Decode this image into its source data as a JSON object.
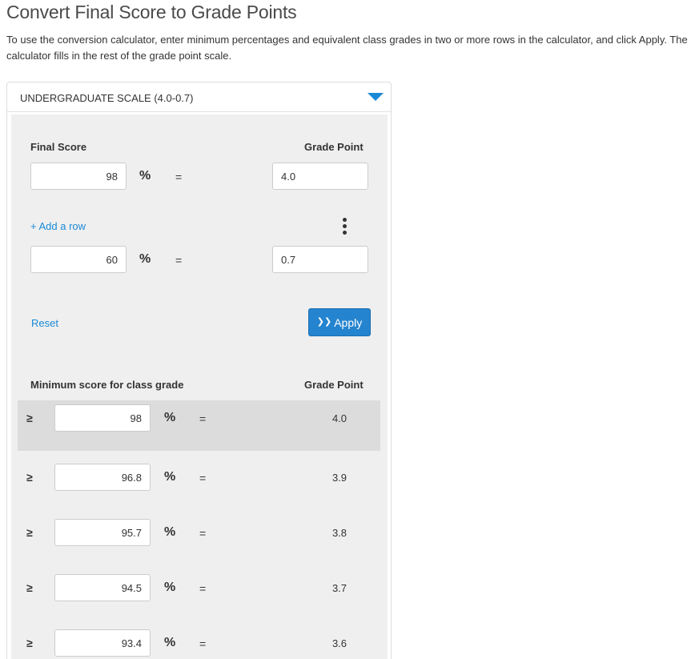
{
  "title": "Convert Final Score to Grade Points",
  "instructions": "To use the conversion calculator, enter minimum percentages and equivalent class grades in two or more rows in the calculator, and click Apply. The calculator fills in the rest of the grade point scale.",
  "scale_select": {
    "value": "UNDERGRADUATE SCALE (4.0-0.7)",
    "icon": "chevron-down-icon"
  },
  "calculator": {
    "final_score_header": "Final Score",
    "grade_point_header": "Grade Point",
    "percent_symbol": "%",
    "equals_symbol": "=",
    "rows": [
      {
        "score": "98",
        "grade_point": "4.0"
      },
      {
        "score": "60",
        "grade_point": "0.7"
      }
    ],
    "add_row_label": "+ Add a row",
    "more_icon": "vertical-ellipsis-icon",
    "reset_label": "Reset",
    "apply_label": "Apply",
    "apply_icon": "double-chevron-down-icon"
  },
  "scale_table": {
    "min_score_header": "Minimum score for class grade",
    "grade_point_header": "Grade Point",
    "gte_symbol": "≥",
    "percent_symbol": "%",
    "equals_symbol": "=",
    "rows": [
      {
        "min_score": "98",
        "grade_point": "4.0",
        "highlighted": true
      },
      {
        "min_score": "96.8",
        "grade_point": "3.9",
        "highlighted": false
      },
      {
        "min_score": "95.7",
        "grade_point": "3.8",
        "highlighted": false
      },
      {
        "min_score": "94.5",
        "grade_point": "3.7",
        "highlighted": false
      },
      {
        "min_score": "93.4",
        "grade_point": "3.6",
        "highlighted": false
      }
    ]
  }
}
